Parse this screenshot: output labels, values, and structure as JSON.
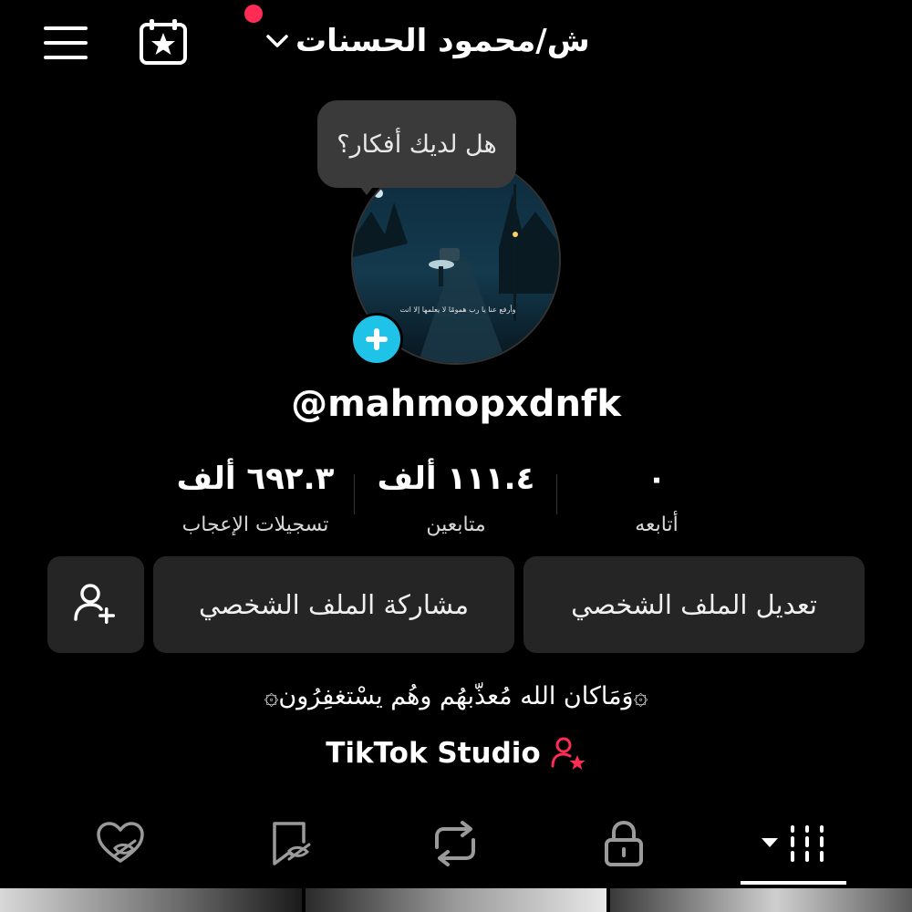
{
  "header": {
    "title": "ش/محمود الحسنات",
    "menu_icon": "hamburger-menu-icon",
    "calendar_icon": "calendar-star-icon",
    "dropdown_icon": "chevron-down-icon",
    "notification_color": "#fe2c55"
  },
  "profile": {
    "idea_bubble": "هل لديك أفكار؟",
    "username": "@mahmopxdnfk",
    "add_icon": "plus-icon",
    "avatar_caption": "وأرفع عنا يا رب همومًا لا يعلمها إلا انت"
  },
  "stats": {
    "likes_value": "٦٩٢.٣ ألف",
    "likes_label": "تسجيلات الإعجاب",
    "followers_value": "١١١.٤ ألف",
    "followers_label": "متابعين",
    "following_value": "٠",
    "following_label": "أتابعه"
  },
  "actions": {
    "edit_profile": "تعديل الملف الشخصي",
    "share_profile": "مشاركة الملف الشخصي",
    "add_friend_icon": "add-user-icon"
  },
  "bio": {
    "text": "۞وَمَاكان الله مُعذّبهُم وهُم يسْتغفِرُون۞",
    "studio_label": "TikTok Studio",
    "studio_icon": "user-star-icon",
    "accent": "#fe2c55"
  },
  "tabs": {
    "liked_icon": "liked-hidden-icon",
    "favorites_icon": "bookmark-hidden-icon",
    "reposts_icon": "repost-icon",
    "private_icon": "lock-icon",
    "videos_icon": "video-grid-icon"
  }
}
